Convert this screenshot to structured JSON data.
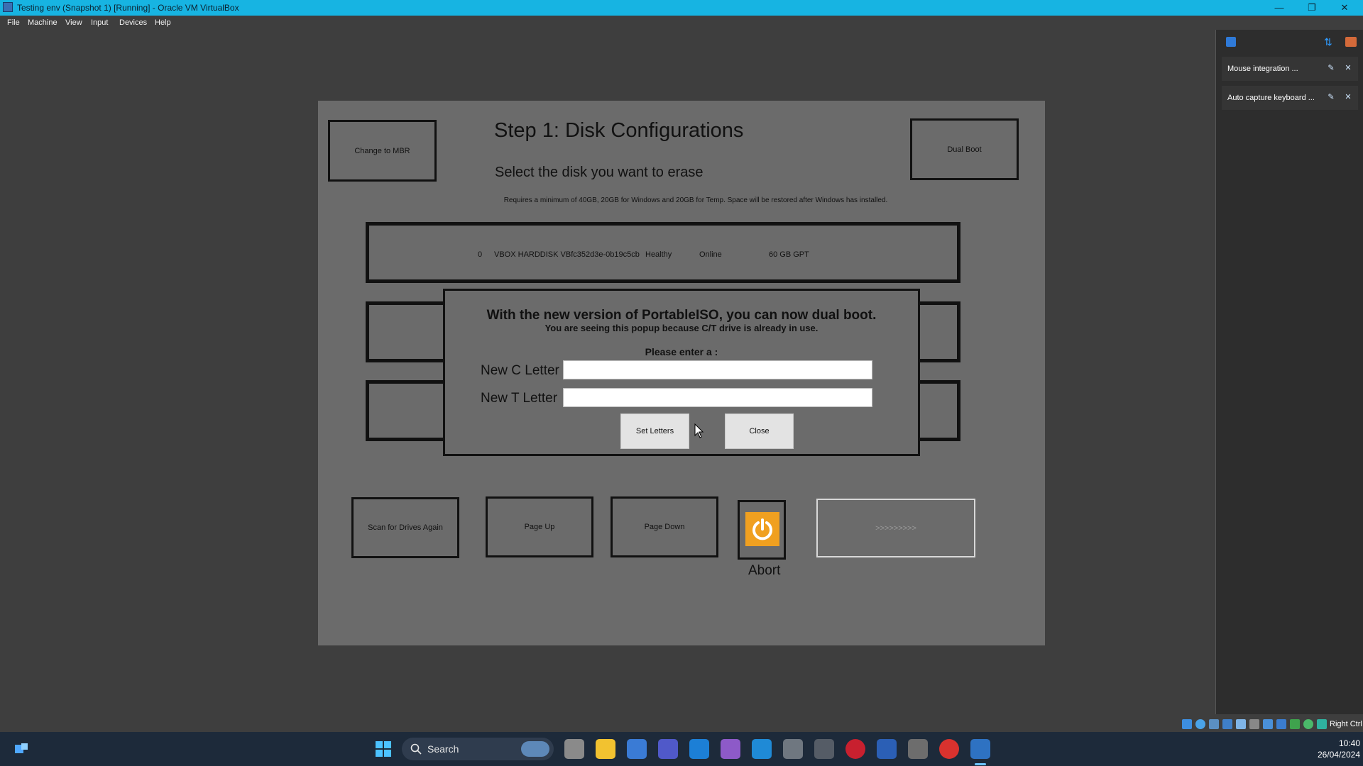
{
  "window": {
    "title": "Testing env (Snapshot 1) [Running] - Oracle VM VirtualBox",
    "minimize_glyph": "—",
    "restore_glyph": "❐",
    "close_glyph": "✕"
  },
  "menu": [
    "File",
    "Machine",
    "View",
    "Input",
    "Devices",
    "Help"
  ],
  "app": {
    "heading": "Step 1: Disk Configurations",
    "subheading": "Select the disk you want to erase",
    "note": "Requires a minimum of 40GB, 20GB for Windows and 20GB for Temp. Space will be restored after Windows has installed.",
    "change_mbr": "Change to MBR",
    "dual_boot": "Dual Boot",
    "disk": {
      "index": "0",
      "name": "VBOX HARDDISK VBfc352d3e-0b19c5cb",
      "health": "Healthy",
      "status": "Online",
      "size": "60 GB GPT"
    },
    "popup": {
      "title": "With the new version of PortableISO, you can now dual boot.",
      "subtitle": "You are seeing this popup because C/T drive is already in use.",
      "prompt": "Please enter a :",
      "c_label": "New C Letter",
      "t_label": "New T Letter",
      "c_value": "",
      "t_value": "",
      "set_button": "Set Letters",
      "close_button": "Close"
    },
    "scan_button": "Scan for Drives Again",
    "page_up": "Page Up",
    "page_down": "Page Down",
    "abort": "Abort",
    "next": ">>>>>>>>>"
  },
  "side_panel": {
    "notifications": [
      "Mouse integration ...",
      "Auto capture keyboard ..."
    ]
  },
  "statusbar": {
    "host_key": "Right Ctrl"
  },
  "taskbar": {
    "search": "Search",
    "time": "10:40",
    "date": "26/04/2024"
  }
}
